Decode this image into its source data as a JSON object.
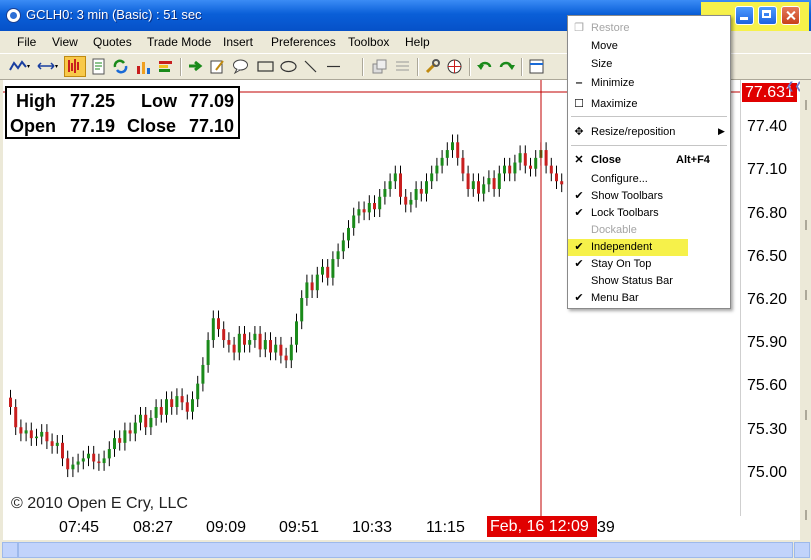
{
  "window": {
    "title": "GCLH0: 3 min (Basic) : 51 sec"
  },
  "menubar": [
    "File",
    "View",
    "Quotes",
    "Trade Mode",
    "Insert",
    "Preferences",
    "Toolbox",
    "Help"
  ],
  "ohlc": {
    "high_label": "High",
    "high_value": "77.25",
    "low_label": "Low",
    "low_value": "77.09",
    "open_label": "Open",
    "open_value": "77.19",
    "close_label": "Close",
    "close_value": "77.10"
  },
  "copyright": "© 2010 Open E Cry, LLC",
  "price_axis": {
    "current": "77.631",
    "labels": [
      "77.40",
      "77.10",
      "76.80",
      "76.50",
      "76.20",
      "75.90",
      "75.60",
      "75.30",
      "75.00"
    ]
  },
  "time_axis": {
    "labels": [
      "07:45",
      "08:27",
      "09:09",
      "09:51",
      "10:33",
      "11:15"
    ],
    "current": "Feb, 16 12:09",
    "tail": "39"
  },
  "context_menu": {
    "items": [
      {
        "label": "Restore",
        "icon": "restore-icon",
        "disabled": true
      },
      {
        "label": "Move",
        "icon": "",
        "disabled": false
      },
      {
        "label": "Size",
        "icon": "",
        "disabled": false
      },
      {
        "label": "Minimize",
        "icon": "minimize-icon",
        "disabled": false
      },
      {
        "label": "Maximize",
        "icon": "maximize-icon",
        "disabled": false
      },
      {
        "label": "Resize/reposition",
        "icon": "move-arrows-icon",
        "submenu": true
      },
      {
        "label": "Close",
        "shortcut": "Alt+F4",
        "icon": "close-icon",
        "bold": true
      },
      {
        "label": "Configure...",
        "icon": ""
      },
      {
        "label": "Show Toolbars",
        "icon": "check-icon",
        "checked": true
      },
      {
        "label": "Lock Toolbars",
        "icon": "check-icon",
        "checked": true
      },
      {
        "label": "Dockable",
        "icon": "",
        "disabled": true
      },
      {
        "label": "Independent",
        "icon": "check-icon",
        "checked": true,
        "highlighted": true
      },
      {
        "label": "Stay On Top",
        "icon": "check-icon",
        "checked": true
      },
      {
        "label": "Show Status Bar",
        "icon": ""
      },
      {
        "label": "Menu Bar",
        "icon": "check-icon",
        "checked": true
      }
    ]
  },
  "colors": {
    "highlight": "#f6f14a",
    "bull_candle": "#1a8a1a",
    "bear_candle": "#c81e1e",
    "crosshair": "#c00000",
    "current_label_bg": "#e00000"
  },
  "chart_data": {
    "type": "candlestick",
    "x_ticks": [
      "07:45",
      "08:27",
      "09:09",
      "09:51",
      "10:33",
      "11:15",
      "Feb, 16 12:09"
    ],
    "y_ticks": [
      77.4,
      77.1,
      76.8,
      76.5,
      76.2,
      75.9,
      75.6,
      75.3,
      75.0
    ],
    "ylim": [
      74.85,
      77.65
    ],
    "crosshair": {
      "price": 77.631,
      "time": "Feb, 16 12:09"
    },
    "closes": [
      75.55,
      75.42,
      75.38,
      75.4,
      75.35,
      75.36,
      75.39,
      75.33,
      75.3,
      75.32,
      75.22,
      75.15,
      75.18,
      75.2,
      75.22,
      75.25,
      75.2,
      75.19,
      75.22,
      75.28,
      75.35,
      75.32,
      75.4,
      75.38,
      75.45,
      75.5,
      75.42,
      75.48,
      75.55,
      75.5,
      75.6,
      75.55,
      75.62,
      75.58,
      75.52,
      75.6,
      75.7,
      75.82,
      75.98,
      76.12,
      76.05,
      75.98,
      75.95,
      75.9,
      76.02,
      75.95,
      75.98,
      76.02,
      75.92,
      75.98,
      75.9,
      75.95,
      75.88,
      75.85,
      75.95,
      76.1,
      76.25,
      76.35,
      76.3,
      76.4,
      76.45,
      76.38,
      76.5,
      76.55,
      76.62,
      76.7,
      76.78,
      76.82,
      76.8,
      76.86,
      76.82,
      76.9,
      76.95,
      77.0,
      77.05,
      76.9,
      76.85,
      76.88,
      76.95,
      76.92,
      77.0,
      77.05,
      77.1,
      77.15,
      77.2,
      77.25,
      77.15,
      77.05,
      76.95,
      77.0,
      76.92,
      76.98,
      77.02,
      76.95,
      77.05,
      77.1,
      77.05,
      77.12,
      77.18,
      77.1,
      77.08,
      77.15,
      77.2,
      77.1,
      77.05,
      77.0,
      76.98
    ]
  }
}
